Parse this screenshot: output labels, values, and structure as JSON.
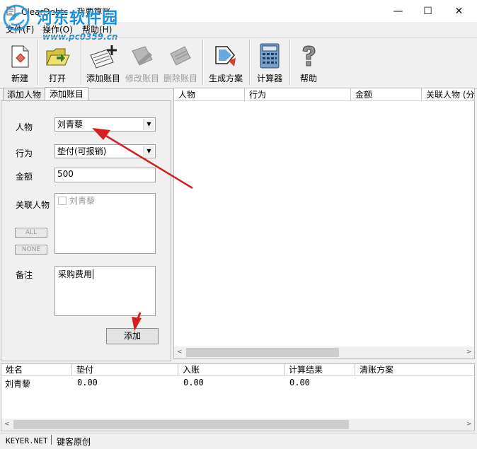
{
  "window": {
    "title": "ClearDebts - 我要算账",
    "minimize": "—",
    "maximize": "☐",
    "close": "✕"
  },
  "watermark": {
    "name": "河东软件园",
    "url": "www.pc0359.cn"
  },
  "menu": {
    "items": [
      "文件(F)",
      "操作(O)",
      "帮助(H)"
    ]
  },
  "toolbar": {
    "buttons": [
      {
        "label": "新建",
        "icon": "new-file-icon",
        "enabled": true
      },
      {
        "label": "打开",
        "icon": "open-folder-icon",
        "enabled": true
      },
      {
        "label": "添加账目",
        "icon": "add-entry-icon",
        "enabled": true
      },
      {
        "label": "修改账目",
        "icon": "edit-entry-icon",
        "enabled": false
      },
      {
        "label": "删除账目",
        "icon": "delete-entry-icon",
        "enabled": false
      },
      {
        "label": "生成方案",
        "icon": "generate-plan-icon",
        "enabled": true
      },
      {
        "label": "计算器",
        "icon": "calculator-icon",
        "enabled": true
      },
      {
        "label": "帮助",
        "icon": "help-icon",
        "enabled": true
      }
    ]
  },
  "tabs": {
    "add_person": "添加人物",
    "add_entry": "添加账目",
    "active": "add_entry"
  },
  "form": {
    "person_label": "人物",
    "person_value": "刘青藜",
    "action_label": "行为",
    "action_value": "垫付(可报销)",
    "amount_label": "金额",
    "amount_value": "500",
    "related_label": "关联人物",
    "related_people": [
      {
        "name": "刘青藜",
        "checked": false
      }
    ],
    "all_button": "ALL",
    "none_button": "NONE",
    "note_label": "备注",
    "note_value": "采购费用",
    "add_button": "添加"
  },
  "entries_table": {
    "columns": [
      "人物",
      "行为",
      "金额",
      "关联人物 (分"
    ],
    "rows": []
  },
  "summary_table": {
    "columns": [
      "姓名",
      "垫付",
      "入账",
      "计算结果",
      "清账方案"
    ],
    "rows": [
      {
        "name": "刘青藜",
        "advance": "0.00",
        "income": "0.00",
        "result": "0.00",
        "plan": ""
      }
    ]
  },
  "statusbar": {
    "site": "KEYER.NET",
    "author": "键客原创"
  },
  "colors": {
    "annotation_arrow": "#d42020",
    "watermark": "#1a8ed8"
  }
}
